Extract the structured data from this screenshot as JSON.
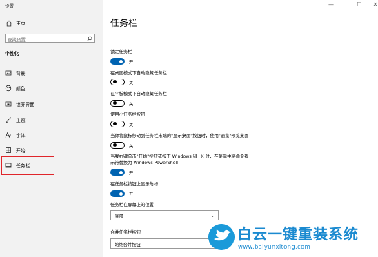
{
  "window": {
    "title": "设置",
    "controls": [
      "—",
      "☐",
      "✕"
    ]
  },
  "sidebar": {
    "home_label": "主页",
    "search_placeholder": "查找设置",
    "section_title": "个性化",
    "items": [
      {
        "label": "背景",
        "icon": "image-icon"
      },
      {
        "label": "颜色",
        "icon": "palette-icon"
      },
      {
        "label": "锁屏界面",
        "icon": "lock-screen-icon"
      },
      {
        "label": "主题",
        "icon": "brush-icon"
      },
      {
        "label": "字体",
        "icon": "font-icon"
      },
      {
        "label": "开始",
        "icon": "start-icon"
      },
      {
        "label": "任务栏",
        "icon": "taskbar-icon",
        "active": true
      }
    ]
  },
  "main": {
    "title": "任务栏",
    "settings": [
      {
        "label": "锁定任务栏",
        "state": "开",
        "on": true
      },
      {
        "label": "在桌面模式下自动隐藏任务栏",
        "state": "关",
        "on": false
      },
      {
        "label": "在平板模式下自动隐藏任务栏",
        "state": "关",
        "on": false
      },
      {
        "label": "使用小任务栏按钮",
        "state": "关",
        "on": false
      },
      {
        "label": "当你将鼠标移动到任务栏末端的\"显示桌面\"按钮时，使用\"速览\"预览桌面",
        "state": "关",
        "on": false
      },
      {
        "label_line1": "当我右键单击\"开始\"按钮或按下 Windows 键+X 时，在菜单中将命令提",
        "label_line2": "示符替换为 Windows PowerShell",
        "state": "开",
        "on": true
      },
      {
        "label": "在任务栏按钮上显示角标",
        "state": "开",
        "on": true
      }
    ],
    "position_label": "任务栏在屏幕上的位置",
    "position_value": "底部",
    "combine_label": "合并任务栏按钮",
    "combine_value": "始终合并按钮"
  },
  "watermark": {
    "text": "白云一键重装系统",
    "url": "www.baiyunxitong.com"
  },
  "colors": {
    "accent": "#0063b1",
    "highlight": "#e0262b",
    "sidebar_bg": "#f2f2f2",
    "brand": "#1b8ad0"
  }
}
